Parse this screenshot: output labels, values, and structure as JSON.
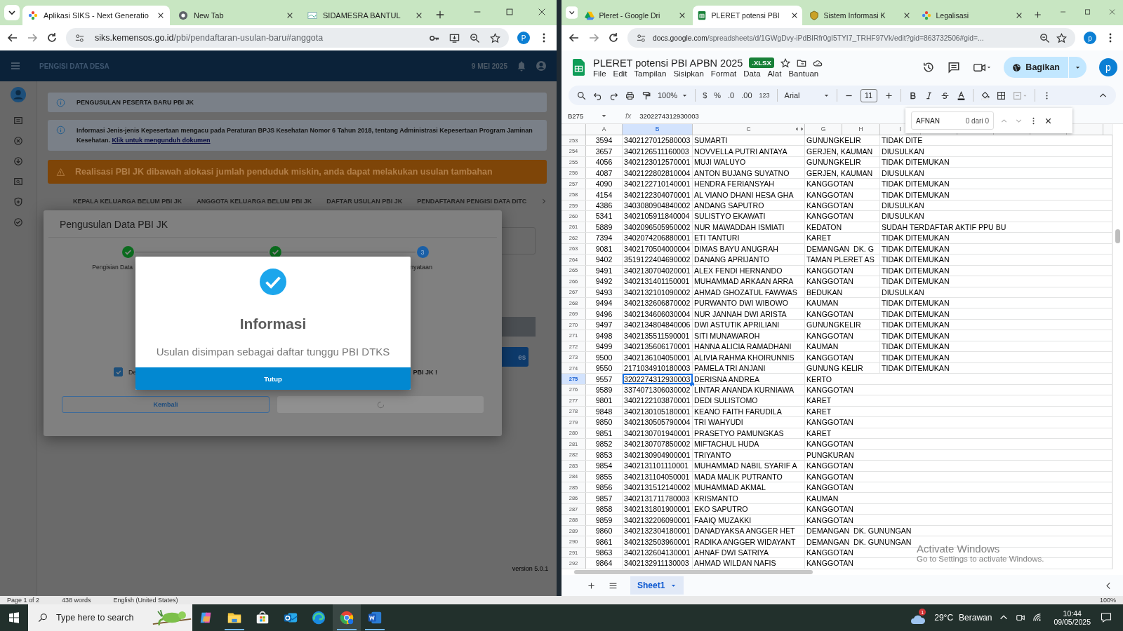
{
  "left_browser": {
    "tabs": [
      {
        "title": "Aplikasi SIKS - Next Generatio",
        "selected": true
      },
      {
        "title": "New Tab",
        "selected": false
      },
      {
        "title": "SIDAMESRA BANTUL",
        "selected": false
      }
    ],
    "url_host": "siks.kemensos.go.id",
    "url_path": "/pbi/pendaftaran-usulan-baru#anggota",
    "profile": "P"
  },
  "siks": {
    "app_title": "PENGISI DATA DESA",
    "date": "9 MEI 2025",
    "section_title": "PENGUSULAN PESERTA BARU PBI JK",
    "info_text": "Informasi Jenis-jenis Kepesertaan mengacu pada Peraturan BPJS Kesehatan Nomor 6 Tahun 2018, tentang Administrasi Kepesertaan Program Jaminan Kesehatan.",
    "info_link": "Klik untuk mengunduh dokumen",
    "warning": "Realisasi PBI JK dibawah alokasi jumlah penduduk miskin, anda dapat melakukan usulan tambahan",
    "tabs": [
      "KEPALA KELUARGA BELUM PBI JK",
      "ANGGOTA KELUARGA BELUM PBI JK",
      "DAFTAR USULAN PBI JK",
      "PENDAFTARAN PENGISI DATA DITC"
    ],
    "background_button": "es",
    "version": "version 5.0.1"
  },
  "dialog": {
    "title": "Pengusulan Data PBI JK",
    "steps": [
      {
        "kind": "done",
        "label": "Pengisian Data"
      },
      {
        "kind": "done"
      },
      {
        "kind": "current",
        "number": "3",
        "label": "nyataan"
      }
    ],
    "checkbox": {
      "label_start": "De",
      "label_end": "PBI JK !",
      "checked": true
    },
    "back_button": "Kembali",
    "submit_loading": true
  },
  "alert": {
    "title": "Informasi",
    "message": "Usulan disimpan sebagai daftar tunggu PBI DTKS",
    "button": "Tutup"
  },
  "right_browser": {
    "tabs": [
      {
        "title": "Pleret - Google Dri",
        "selected": false
      },
      {
        "title": "PLERET potensi PBI",
        "selected": true
      },
      {
        "title": "Sistem Informasi K",
        "selected": false
      },
      {
        "title": "Legalisasi",
        "selected": false
      }
    ],
    "url_host": "docs.google.com",
    "url_path": "/spreadsheets/d/1GWgDvy-iPdBIRfr0gI5TYI7_TRHF97Vk/edit?gid=863732506#gid=...",
    "profile": "p"
  },
  "sheet": {
    "title": "PLERET potensi PBI APBN 2025",
    "badge": ".XLSX",
    "menu": [
      "File",
      "Edit",
      "Tampilan",
      "Sisipkan",
      "Format",
      "Data",
      "Alat",
      "Bantuan"
    ],
    "share_button": "Bagikan",
    "profile": "p",
    "toolbar": {
      "zoom": "100%",
      "currency": "$",
      "percent": "%",
      "decrease_decimal": ".0",
      "increase_decimal": ".00",
      "number_format": "123",
      "font": "Arial",
      "font_size": "11"
    },
    "name_box": "B275",
    "fx": "fx",
    "formula": "3202274312930003",
    "columns": [
      {
        "label": "A",
        "selected": false
      },
      {
        "label": "B",
        "selected": true
      },
      {
        "label": "C",
        "selected": false
      },
      {
        "label": "G",
        "selected": false
      },
      {
        "label": "H",
        "selected": false
      },
      {
        "label": "I",
        "selected": false
      }
    ],
    "rows": [
      {
        "number": "253",
        "cells": [
          "3594",
          "3402127012580003",
          "SUMARTI",
          "GUNUNGKELIR",
          "TIDAK DITE"
        ],
        "selected": false
      },
      {
        "number": "254",
        "cells": [
          "3657",
          "3402126511160003",
          "NOVVELLA PUTRI ANTAYA",
          "GERJEN, KAUMAN",
          "DIUSULKAN"
        ],
        "selected": false
      },
      {
        "number": "255",
        "cells": [
          "4056",
          "3402123012570001",
          "MUJI WALUYO",
          "GUNUNGKELIR",
          "TIDAK DITEMUKAN"
        ],
        "selected": false
      },
      {
        "number": "256",
        "cells": [
          "4087",
          "3402122802810004",
          "ANTON BUJANG SUYATNO",
          "GERJEN, KAUMAN",
          "DIUSULKAN"
        ],
        "selected": false
      },
      {
        "number": "257",
        "cells": [
          "4090",
          "3402122710140001",
          "HENDRA FERIANSYAH",
          "KANGGOTAN",
          "TIDAK DITEMUKAN"
        ],
        "selected": false
      },
      {
        "number": "258",
        "cells": [
          "4154",
          "3402122304070001",
          "AL VIANO DHANI HESA GHA",
          "KANGGOTAN",
          "TIDAK DITEMUKAN"
        ],
        "selected": false
      },
      {
        "number": "259",
        "cells": [
          "4386",
          "3403080904840002",
          "ANDANG SAPUTRO",
          "KANGGOTAN",
          "DIUSULKAN"
        ],
        "selected": false
      },
      {
        "number": "260",
        "cells": [
          "5341",
          "3402105911840004",
          "SULISTYO EKAWATI",
          "KANGGOTAN",
          "DIUSULKAN"
        ],
        "selected": false
      },
      {
        "number": "261",
        "cells": [
          "5889",
          "3402096505950002",
          "NUR MAWADDAH ISMIATI",
          "KEDATON",
          "SUDAH TERDAFTAR AKTIF PPU BU"
        ],
        "selected": false
      },
      {
        "number": "262",
        "cells": [
          "7394",
          "3402074206880001",
          "ETI TANTURI",
          "KARET",
          "TIDAK DITEMUKAN"
        ],
        "selected": false
      },
      {
        "number": "263",
        "cells": [
          "9081",
          "3402170504000004",
          "DIMAS BAYU ANUGRAH",
          "DEMANGAN  DK. G",
          "TIDAK DITEMUKAN"
        ],
        "selected": false
      },
      {
        "number": "264",
        "cells": [
          "9402",
          "3519122404690002",
          "DANANG APRIJANTO",
          "TAMAN PLERET AS",
          "TIDAK DITEMUKAN"
        ],
        "selected": false
      },
      {
        "number": "265",
        "cells": [
          "9491",
          "3402130704020001",
          "ALEX FENDI HERNANDO",
          "KANGGOTAN",
          "TIDAK DITEMUKAN"
        ],
        "selected": false
      },
      {
        "number": "266",
        "cells": [
          "9492",
          "3402131401150001",
          "MUHAMMAD ARKAAN ARRA",
          "KANGGOTAN",
          "TIDAK DITEMUKAN"
        ],
        "selected": false
      },
      {
        "number": "267",
        "cells": [
          "9493",
          "3402132101090002",
          "AHMAD GHOZATUL FAWWAS",
          "BEDUKAN",
          "DIUSULKAN"
        ],
        "selected": false
      },
      {
        "number": "268",
        "cells": [
          "9494",
          "3402132606870002",
          "PURWANTO DWI WIBOWO",
          "KAUMAN",
          "TIDAK DITEMUKAN"
        ],
        "selected": false
      },
      {
        "number": "269",
        "cells": [
          "9496",
          "3402134606030004",
          "NUR JANNAH DWI ARISTA",
          "KANGGOTAN",
          "TIDAK DITEMUKAN"
        ],
        "selected": false
      },
      {
        "number": "270",
        "cells": [
          "9497",
          "3402134804840006",
          "DWI ASTUTIK APRILIANI",
          "GUNUNGKELIR",
          "TIDAK DITEMUKAN"
        ],
        "selected": false
      },
      {
        "number": "271",
        "cells": [
          "9498",
          "3402135511590001",
          "SITI MUNAWAROH",
          "KANGGOTAN",
          "TIDAK DITEMUKAN"
        ],
        "selected": false
      },
      {
        "number": "272",
        "cells": [
          "9499",
          "3402135606170001",
          "HANNA ALICIA RAMADHANI",
          "KAUMAN",
          "TIDAK DITEMUKAN"
        ],
        "selected": false
      },
      {
        "number": "273",
        "cells": [
          "9500",
          "3402136104050001",
          "ALIVIA RAHMA KHOIRUNNIS",
          "KANGGOTAN",
          "TIDAK DITEMUKAN"
        ],
        "selected": false
      },
      {
        "number": "274",
        "cells": [
          "9550",
          "2171034910180003",
          "PAMELA TRI ANJANI",
          "GUNUNG KELIR",
          "TIDAK DITEMUKAN"
        ],
        "selected": false
      },
      {
        "number": "275",
        "cells": [
          "9557",
          "3202274312930003",
          "DERISNA ANDREA",
          "KERTO"
        ],
        "selected": true
      },
      {
        "number": "276",
        "cells": [
          "9589",
          "3374071306030002",
          "LINTAR ANANDA KURNIAWA",
          "KANGGOTAN"
        ],
        "selected": false
      },
      {
        "number": "277",
        "cells": [
          "9801",
          "3402122103870001",
          "DEDI SULISTOMO",
          "KARET"
        ],
        "selected": false
      },
      {
        "number": "278",
        "cells": [
          "9848",
          "3402130105180001",
          "KEANO FAITH FARUDILA",
          "KARET"
        ],
        "selected": false
      },
      {
        "number": "279",
        "cells": [
          "9850",
          "3402130505790004",
          "TRI WAHYUDI",
          "KANGGOTAN"
        ],
        "selected": false
      },
      {
        "number": "280",
        "cells": [
          "9851",
          "3402130701940001",
          "PRASETYO PAMUNGKAS",
          "KARET"
        ],
        "selected": false
      },
      {
        "number": "281",
        "cells": [
          "9852",
          "3402130707850002",
          "MIFTACHUL HUDA",
          "KANGGOTAN"
        ],
        "selected": false
      },
      {
        "number": "282",
        "cells": [
          "9853",
          "3402130904900001",
          "TRIYANTO",
          "PUNGKURAN"
        ],
        "selected": false
      },
      {
        "number": "283",
        "cells": [
          "9854",
          "3402131101110001",
          "MUHAMMAD NABIL SYARIF A",
          "KANGGOTAN"
        ],
        "selected": false
      },
      {
        "number": "284",
        "cells": [
          "9855",
          "3402131104050001",
          "MADA MALIK PUTRANTO",
          "KANGGOTAN"
        ],
        "selected": false
      },
      {
        "number": "285",
        "cells": [
          "9856",
          "3402131512140002",
          "MUHAMMAD AKMAL",
          "KANGGOTAN"
        ],
        "selected": false
      },
      {
        "number": "286",
        "cells": [
          "9857",
          "3402131711780003",
          "KRISMANTO",
          "KAUMAN"
        ],
        "selected": false
      },
      {
        "number": "287",
        "cells": [
          "9858",
          "3402131801900001",
          "EKO SAPUTRO",
          "KANGGOTAN"
        ],
        "selected": false
      },
      {
        "number": "288",
        "cells": [
          "9859",
          "3402132206090001",
          "FAAIQ MUZAKKI",
          "KANGGOTAN"
        ],
        "selected": false
      },
      {
        "number": "289",
        "cells": [
          "9860",
          "3402132304180001",
          "DANADYAKSA ANGGER HET",
          "DEMANGAN  DK. GUNUNGAN"
        ],
        "selected": false
      },
      {
        "number": "290",
        "cells": [
          "9861",
          "3402132503960001",
          "RADIKA ANGGER WIDAYANT",
          "DEMANGAN  DK. GUNUNGAN"
        ],
        "selected": false
      },
      {
        "number": "291",
        "cells": [
          "9863",
          "3402132604130001",
          "AHNAF DWI SATRIYA",
          "KANGGOTAN"
        ],
        "selected": false
      },
      {
        "number": "292",
        "cells": [
          "9864",
          "3402132911130003",
          "AHMAD WILDAN NAFIS",
          "KANGGOTAN"
        ],
        "selected": false
      }
    ],
    "sheet_tabs": [
      {
        "label": "Sheet1",
        "selected": true
      }
    ],
    "find": {
      "query": "AFNAN",
      "count": "0 dari 0"
    }
  },
  "windows_notice": {
    "title": "Activate Windows",
    "text": "Go to Settings to activate Windows."
  },
  "word_status": {
    "page": "Page 1 of 2",
    "words": "438 words",
    "language": "English (United States)",
    "zoom": "100%"
  },
  "taskbar": {
    "search_placeholder": "Type here to search",
    "apps": [
      {
        "kind": "copilot",
        "running": false,
        "selected": false
      },
      {
        "kind": "folder",
        "running": true,
        "selected": false
      },
      {
        "kind": "store",
        "running": false,
        "selected": false
      },
      {
        "kind": "mail",
        "running": false,
        "selected": false
      },
      {
        "kind": "edge",
        "running": false,
        "selected": false
      },
      {
        "kind": "chrome",
        "running": true,
        "selected": true
      },
      {
        "kind": "word",
        "running": true,
        "selected": false
      }
    ],
    "weather_badge": "1",
    "temperature": "29°C",
    "weather": "Berawan",
    "time": "10:44",
    "date": "09/05/2025"
  }
}
